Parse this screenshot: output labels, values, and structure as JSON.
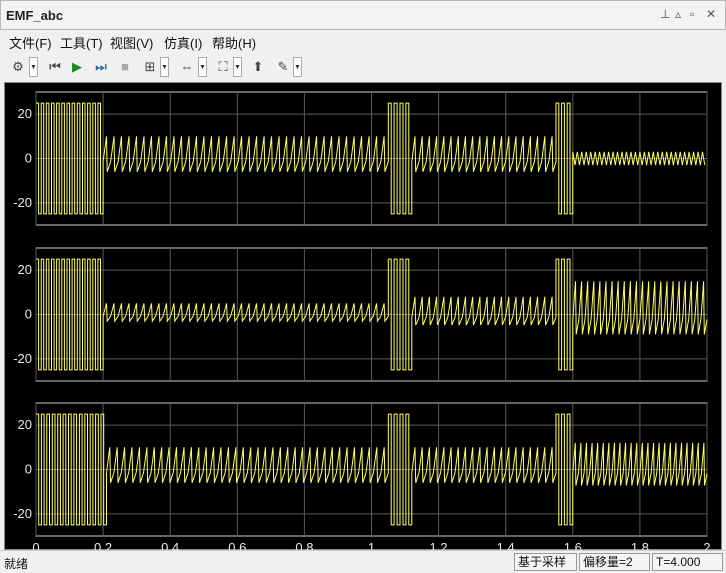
{
  "window": {
    "title": "EMF_abc",
    "controls": [
      "pin-icon",
      "up-arrow-icon",
      "restore-icon",
      "close-icon"
    ]
  },
  "menu": {
    "items": [
      "文件(F)",
      "工具(T)",
      "视图(V)",
      "仿真(I)",
      "帮助(H)"
    ]
  },
  "toolbar": {
    "icons": [
      "settings-icon",
      "step-back-icon",
      "run-icon",
      "step-forward-icon",
      "stop-icon",
      "signal-select-icon",
      "zoom-x-icon",
      "fit-icon",
      "pan-icon",
      "highlight-icon"
    ]
  },
  "status": {
    "ready": "就绪",
    "mode": "基于采样",
    "offset": "偏移量=2",
    "time": "T=4.000"
  },
  "chart_data": [
    {
      "type": "line",
      "title": "",
      "xlim": [
        0,
        2
      ],
      "ylim": [
        -30,
        30
      ],
      "yticks": [
        -20,
        0,
        20
      ],
      "xticks": [
        0,
        0.2,
        0.4,
        0.6,
        0.8,
        1,
        1.2,
        1.4,
        1.6,
        1.8,
        2
      ],
      "grid": true,
      "series": [
        {
          "color": "#ffff66",
          "segments": [
            {
              "t0": 0,
              "t1": 0.2,
              "amplitude": 25,
              "kind": "square",
              "cycles": 13
            },
            {
              "t0": 0.2,
              "t1": 1.05,
              "amplitude": 10,
              "kind": "spike",
              "cycles": 38
            },
            {
              "t0": 1.05,
              "t1": 1.12,
              "amplitude": 25,
              "kind": "square",
              "cycles": 4
            },
            {
              "t0": 1.12,
              "t1": 1.55,
              "amplitude": 10,
              "kind": "spike",
              "cycles": 20
            },
            {
              "t0": 1.55,
              "t1": 1.6,
              "amplitude": 25,
              "kind": "square",
              "cycles": 3
            },
            {
              "t0": 1.6,
              "t1": 2,
              "amplitude": 3,
              "kind": "noise",
              "cycles": 30
            }
          ]
        }
      ]
    },
    {
      "type": "line",
      "title": "",
      "xlim": [
        0,
        2
      ],
      "ylim": [
        -30,
        30
      ],
      "yticks": [
        -20,
        0,
        20
      ],
      "xticks": [
        0,
        0.2,
        0.4,
        0.6,
        0.8,
        1,
        1.2,
        1.4,
        1.6,
        1.8,
        2
      ],
      "grid": true,
      "series": [
        {
          "color": "#ffff66",
          "segments": [
            {
              "t0": 0,
              "t1": 0.2,
              "amplitude": 25,
              "kind": "square",
              "cycles": 13
            },
            {
              "t0": 0.2,
              "t1": 1.05,
              "amplitude": 5,
              "kind": "spike",
              "cycles": 38
            },
            {
              "t0": 1.05,
              "t1": 1.12,
              "amplitude": 25,
              "kind": "square",
              "cycles": 4
            },
            {
              "t0": 1.12,
              "t1": 1.55,
              "amplitude": 8,
              "kind": "spike",
              "cycles": 20
            },
            {
              "t0": 1.55,
              "t1": 1.6,
              "amplitude": 25,
              "kind": "square",
              "cycles": 3
            },
            {
              "t0": 1.6,
              "t1": 2,
              "amplitude": 15,
              "kind": "spike",
              "cycles": 22
            }
          ]
        }
      ]
    },
    {
      "type": "line",
      "title": "",
      "xlim": [
        0,
        2
      ],
      "ylim": [
        -30,
        30
      ],
      "yticks": [
        -20,
        0,
        20
      ],
      "xticks": [
        0,
        0.2,
        0.4,
        0.6,
        0.8,
        1,
        1.2,
        1.4,
        1.6,
        1.8,
        2
      ],
      "xticklabels": [
        "0",
        "0.2",
        "0.4",
        "0.6",
        "0.8",
        "1",
        "1.2",
        "1.4",
        "1.6",
        "1.8",
        "2"
      ],
      "grid": true,
      "series": [
        {
          "color": "#ffff66",
          "segments": [
            {
              "t0": 0,
              "t1": 0.21,
              "amplitude": 25,
              "kind": "square",
              "cycles": 13
            },
            {
              "t0": 0.21,
              "t1": 1.05,
              "amplitude": 10,
              "kind": "spike",
              "cycles": 38
            },
            {
              "t0": 1.05,
              "t1": 1.12,
              "amplitude": 25,
              "kind": "square",
              "cycles": 4
            },
            {
              "t0": 1.12,
              "t1": 1.55,
              "amplitude": 10,
              "kind": "spike",
              "cycles": 20
            },
            {
              "t0": 1.55,
              "t1": 1.6,
              "amplitude": 25,
              "kind": "square",
              "cycles": 3
            },
            {
              "t0": 1.6,
              "t1": 2,
              "amplitude": 12,
              "kind": "spike",
              "cycles": 24
            }
          ]
        }
      ]
    }
  ]
}
